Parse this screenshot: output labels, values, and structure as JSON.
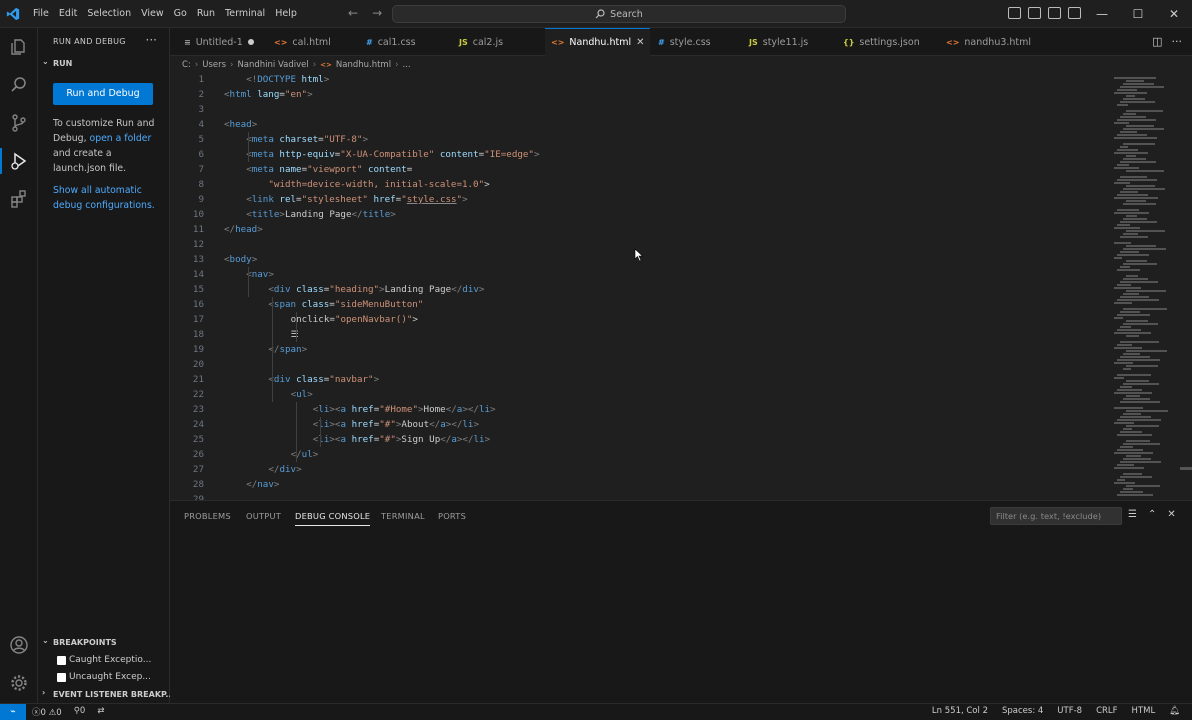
{
  "menus": [
    "File",
    "Edit",
    "Selection",
    "View",
    "Go",
    "Run",
    "Terminal",
    "Help"
  ],
  "search": {
    "label": "Search"
  },
  "sidebar": {
    "title": "RUN AND DEBUG",
    "section": "RUN",
    "run_button": "Run and Debug",
    "help_pre": "To customize Run and Debug,",
    "help_link": "open a folder",
    "help_post": "and create a launch.json file.",
    "show_all_link": "Show all automatic debug configurations.",
    "breakpoints_title": "BREAKPOINTS",
    "breakpoints": [
      "Caught Exceptio...",
      "Uncaught Excep..."
    ],
    "event_listener_title": "EVENT LISTENER BREAKP..."
  },
  "tabs": [
    {
      "label": "Untitled-1",
      "icon": "",
      "dirty": true
    },
    {
      "label": "cal.html",
      "icon": "<>"
    },
    {
      "label": "cal1.css",
      "icon": "#"
    },
    {
      "label": "cal2.js",
      "icon": "JS"
    },
    {
      "label": "Nandhu.html",
      "icon": "<>",
      "active": true
    },
    {
      "label": "style.css",
      "icon": "#"
    },
    {
      "label": "style11.js",
      "icon": "JS"
    },
    {
      "label": "settings.json",
      "icon": "{}"
    },
    {
      "label": "nandhu3.html",
      "icon": "<>"
    }
  ],
  "breadcrumb": [
    "C:",
    "Users",
    "Nandhini Vadivel",
    "Nandhu.html",
    "..."
  ],
  "editor": {
    "lines": [
      {
        "n": "1",
        "text": "    <!DOCTYPE html>"
      },
      {
        "n": "2",
        "text": "<html lang=\"en\">"
      },
      {
        "n": "3",
        "text": ""
      },
      {
        "n": "4",
        "text": "<head>"
      },
      {
        "n": "5",
        "text": "    <meta charset=\"UTF-8\">"
      },
      {
        "n": "6",
        "text": "    <meta http-equiv=\"X-UA-Compatible\" content=\"IE=edge\">"
      },
      {
        "n": "7",
        "text": "    <meta name=\"viewport\" content="
      },
      {
        "n": "8",
        "text": "        \"width=device-width, initial-scale=1.0\">"
      },
      {
        "n": "9",
        "text": "    <link rel=\"stylesheet\" href=\"style.css\">"
      },
      {
        "n": "10",
        "text": "    <title>Landing Page</title>"
      },
      {
        "n": "11",
        "text": "</head>"
      },
      {
        "n": "12",
        "text": ""
      },
      {
        "n": "13",
        "text": "<body>"
      },
      {
        "n": "14",
        "text": "    <nav>"
      },
      {
        "n": "15",
        "text": "        <div class=\"heading\">Landing Page</div>"
      },
      {
        "n": "16",
        "text": "        <span class=\"sideMenuButton\""
      },
      {
        "n": "17",
        "text": "            onclick=\"openNavbar()\">"
      },
      {
        "n": "18",
        "text": "            ☰"
      },
      {
        "n": "19",
        "text": "        </span>"
      },
      {
        "n": "20",
        "text": ""
      },
      {
        "n": "21",
        "text": "        <div class=\"navbar\">"
      },
      {
        "n": "22",
        "text": "            <ul>"
      },
      {
        "n": "23",
        "text": "                <li><a href=\"#Home\">Home</a></li>"
      },
      {
        "n": "24",
        "text": "                <li><a href=\"#\">About</a></li>"
      },
      {
        "n": "25",
        "text": "                <li><a href=\"#\">Sign Up</a></li>"
      },
      {
        "n": "26",
        "text": "            </ul>"
      },
      {
        "n": "27",
        "text": "        </div>"
      },
      {
        "n": "28",
        "text": "    </nav>"
      },
      {
        "n": "29",
        "text": ""
      }
    ]
  },
  "panel": {
    "tabs": [
      "PROBLEMS",
      "OUTPUT",
      "DEBUG CONSOLE",
      "TERMINAL",
      "PORTS"
    ],
    "active": "DEBUG CONSOLE",
    "filter_placeholder": "Filter (e.g. text, !exclude)"
  },
  "status": {
    "errors": "0",
    "warnings": "0",
    "ports": "0",
    "position": "Ln 551, Col 2",
    "spaces": "Spaces: 4",
    "encoding": "UTF-8",
    "eol": "CRLF",
    "language": "HTML"
  },
  "colors": {
    "accent": "#0078d4",
    "link": "#4daafc",
    "bg": "#1f1f1f"
  }
}
